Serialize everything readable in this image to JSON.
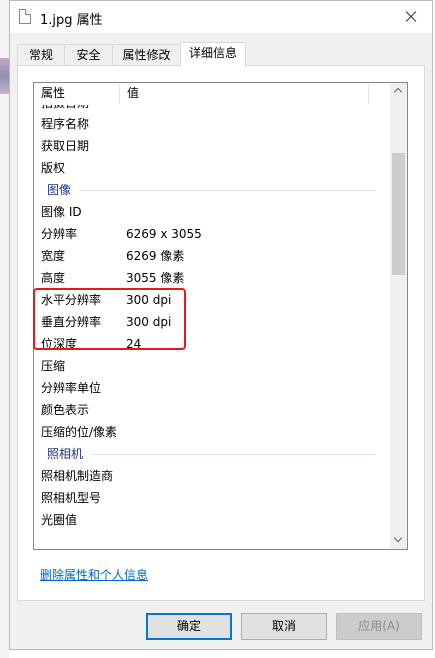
{
  "window": {
    "title": "1.jpg 属性"
  },
  "tabs": [
    {
      "label": "常规"
    },
    {
      "label": "安全"
    },
    {
      "label": "属性修改"
    },
    {
      "label": "详细信息"
    }
  ],
  "list": {
    "header": {
      "property": "属性",
      "value": "值"
    },
    "clipped_top_label": "拍摄日期",
    "rows": [
      {
        "type": "row",
        "name": "程序名称",
        "value": ""
      },
      {
        "type": "row",
        "name": "获取日期",
        "value": ""
      },
      {
        "type": "row",
        "name": "版权",
        "value": ""
      },
      {
        "type": "group",
        "name": "图像"
      },
      {
        "type": "row",
        "name": "图像 ID",
        "value": ""
      },
      {
        "type": "row",
        "name": "分辨率",
        "value": "6269 x 3055"
      },
      {
        "type": "row",
        "name": "宽度",
        "value": "6269 像素"
      },
      {
        "type": "row",
        "name": "高度",
        "value": "3055 像素"
      },
      {
        "type": "row",
        "name": "水平分辨率",
        "value": "300 dpi"
      },
      {
        "type": "row",
        "name": "垂直分辨率",
        "value": "300 dpi"
      },
      {
        "type": "row",
        "name": "位深度",
        "value": "24"
      },
      {
        "type": "row",
        "name": "压缩",
        "value": ""
      },
      {
        "type": "row",
        "name": "分辨率单位",
        "value": ""
      },
      {
        "type": "row",
        "name": "颜色表示",
        "value": ""
      },
      {
        "type": "row",
        "name": "压缩的位/像素",
        "value": ""
      },
      {
        "type": "group",
        "name": "照相机"
      },
      {
        "type": "row",
        "name": "照相机制造商",
        "value": ""
      },
      {
        "type": "row",
        "name": "照相机型号",
        "value": ""
      },
      {
        "type": "row",
        "name": "光圈值",
        "value": ""
      }
    ]
  },
  "remove_link": "删除属性和个人信息",
  "buttons": {
    "ok": "确定",
    "cancel": "取消",
    "apply": "应用(A)"
  },
  "colors": {
    "highlight": "#e8171d",
    "group_label": "#1e3287",
    "link": "#0066cc",
    "default_button_border": "#0078d7"
  }
}
